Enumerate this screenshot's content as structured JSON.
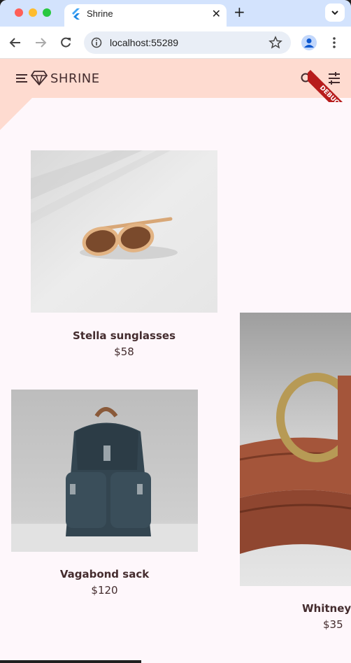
{
  "browser": {
    "tab_title": "Shrine",
    "tab_close": "✕",
    "new_tab": "+",
    "url": "localhost:55289"
  },
  "appbar": {
    "brand": "SHRINE",
    "debug_banner": "DEBUG"
  },
  "products": [
    {
      "name": "Stella sunglasses",
      "price": "$58",
      "image": "sunglasses-photo"
    },
    {
      "name": "Vagabond sack",
      "price": "$120",
      "image": "backpack-photo"
    },
    {
      "name": "Whitney b",
      "price": "$35",
      "image": "belt-photo"
    }
  ],
  "colors": {
    "appbar_bg": "#fedbd0",
    "page_bg": "#fef7fb",
    "text": "#442c2e",
    "debug_ribbon": "#b71c1c"
  },
  "icons": [
    "menu-icon",
    "diamond-logo-icon",
    "search-icon",
    "filter-icon"
  ]
}
